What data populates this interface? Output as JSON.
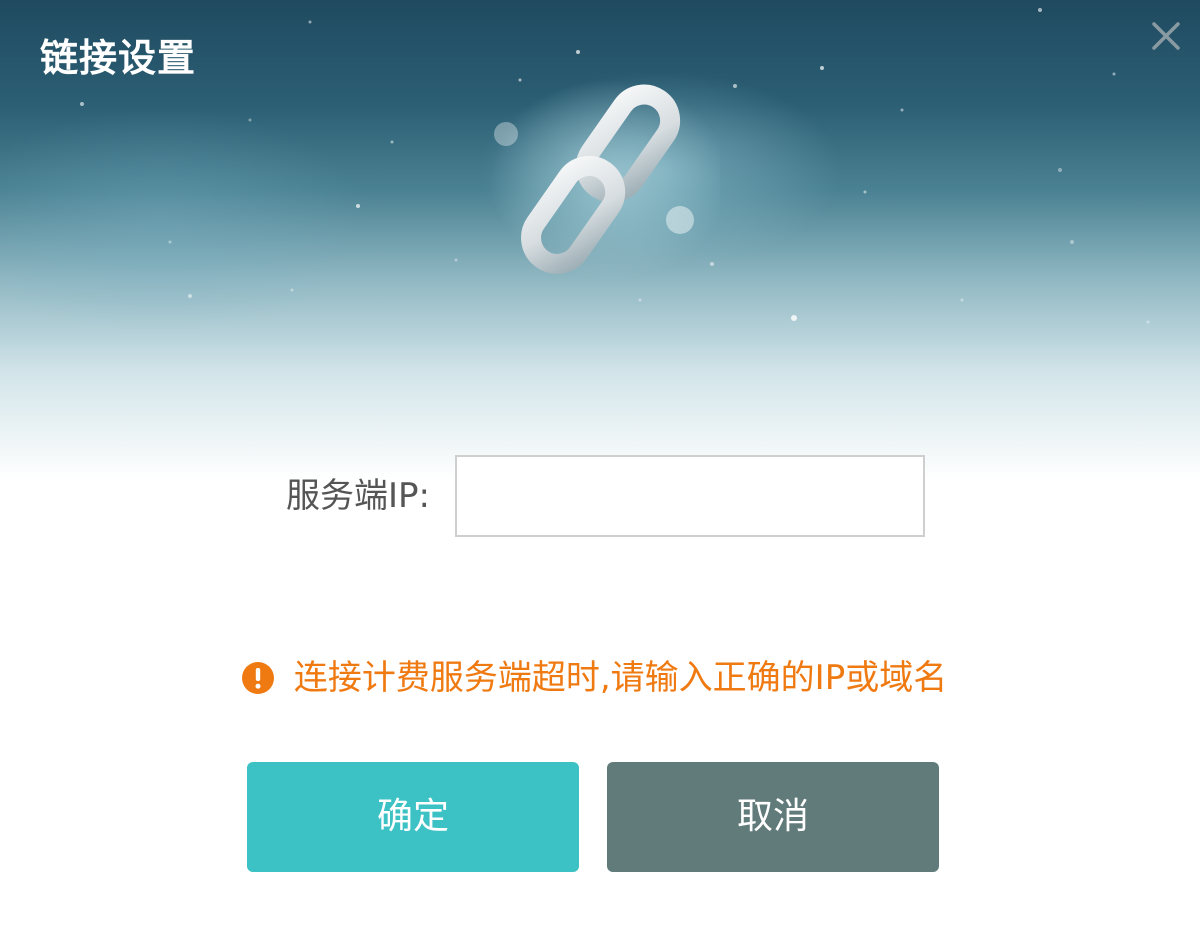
{
  "dialog": {
    "title": "链接设置",
    "close_icon": "close-icon",
    "header_icon": "chain-link-icon"
  },
  "form": {
    "server_ip_label": "服务端IP:",
    "server_ip_value": "",
    "server_ip_placeholder": ""
  },
  "error": {
    "icon": "warning-icon",
    "message": "连接计费服务端超时,请输入正确的IP或域名",
    "color": "#f07a12"
  },
  "buttons": {
    "confirm_label": "确定",
    "cancel_label": "取消",
    "confirm_color": "#3cc1c4",
    "cancel_color": "#617b7a"
  }
}
